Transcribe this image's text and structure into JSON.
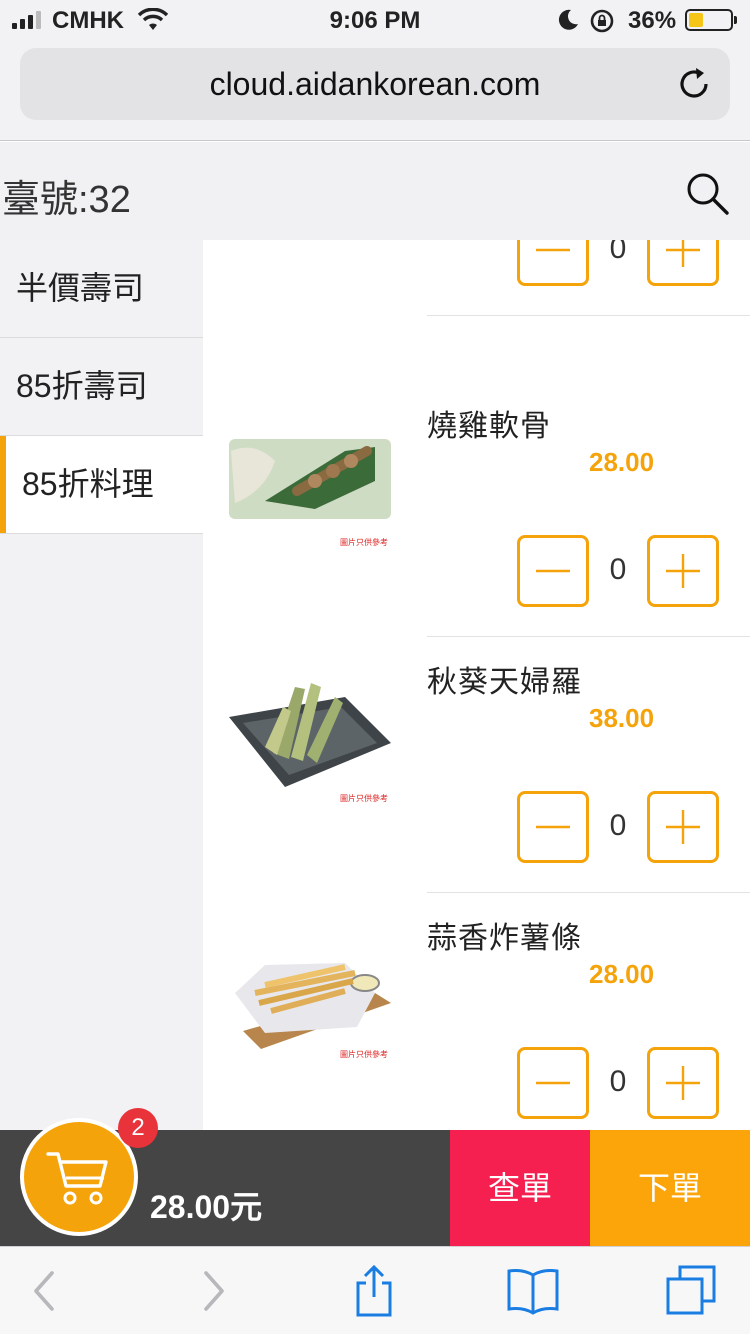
{
  "status_bar": {
    "carrier": "CMHK",
    "time": "9:06 PM",
    "battery_percent": "36%",
    "battery_level": 0.36,
    "icons": [
      "signal-icon",
      "wifi-icon",
      "moon-icon",
      "rotation-lock-icon",
      "battery-icon"
    ]
  },
  "browser": {
    "url": "cloud.aidankorean.com",
    "icons": [
      "reload-icon",
      "back-icon",
      "forward-icon",
      "share-icon",
      "bookmarks-icon",
      "tabs-icon"
    ]
  },
  "header": {
    "table_label": "臺號:32",
    "search_icon": "search-icon"
  },
  "sidebar": {
    "categories": [
      {
        "label": "半價壽司",
        "active": false
      },
      {
        "label": "85折壽司",
        "active": false
      },
      {
        "label": "85折料理",
        "active": true
      }
    ]
  },
  "menu": {
    "image_note": "圖片只供參考",
    "items": [
      {
        "name": "",
        "price": "",
        "qty": "0"
      },
      {
        "name": "燒雞軟骨",
        "price": "28.00",
        "qty": "0"
      },
      {
        "name": "秋葵天婦羅",
        "price": "38.00",
        "qty": "0"
      },
      {
        "name": "蒜香炸薯條",
        "price": "28.00",
        "qty": "0"
      }
    ]
  },
  "cart": {
    "count": "2",
    "total": "28.00元",
    "check_label": "查單",
    "order_label": "下單"
  },
  "colors": {
    "accent": "#f5a30a",
    "check_button": "#f5204f",
    "order_button": "#fba50b",
    "badge": "#e8333a",
    "cart_bar": "#454545"
  }
}
